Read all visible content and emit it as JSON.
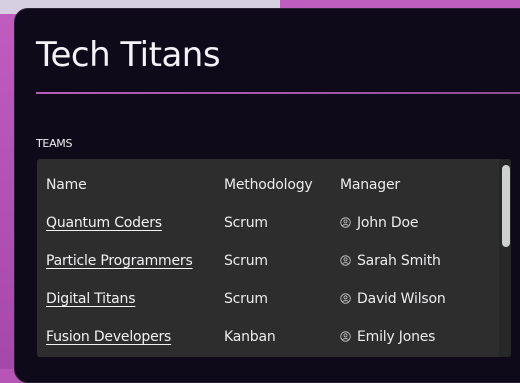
{
  "page": {
    "title": "Tech Titans",
    "section_label": "TEAMS"
  },
  "table": {
    "headers": {
      "name": "Name",
      "methodology": "Methodology",
      "manager": "Manager"
    },
    "rows": [
      {
        "name": "Quantum Coders",
        "methodology": "Scrum",
        "manager": "John Doe",
        "manager_icon": "user-circle-icon"
      },
      {
        "name": "Particle Programmers",
        "methodology": "Scrum",
        "manager": "Sarah Smith",
        "manager_icon": "user-circle-icon"
      },
      {
        "name": "Digital Titans",
        "methodology": "Scrum",
        "manager": "David Wilson",
        "manager_icon": "user-circle-icon"
      },
      {
        "name": "Fusion Developers",
        "methodology": "Kanban",
        "manager": "Emily Jones",
        "manager_icon": "user-circle-icon"
      }
    ]
  },
  "colors": {
    "accent": "#b35db7",
    "panel_bg": "#0f0a1a",
    "table_bg": "#2c2d2c"
  }
}
